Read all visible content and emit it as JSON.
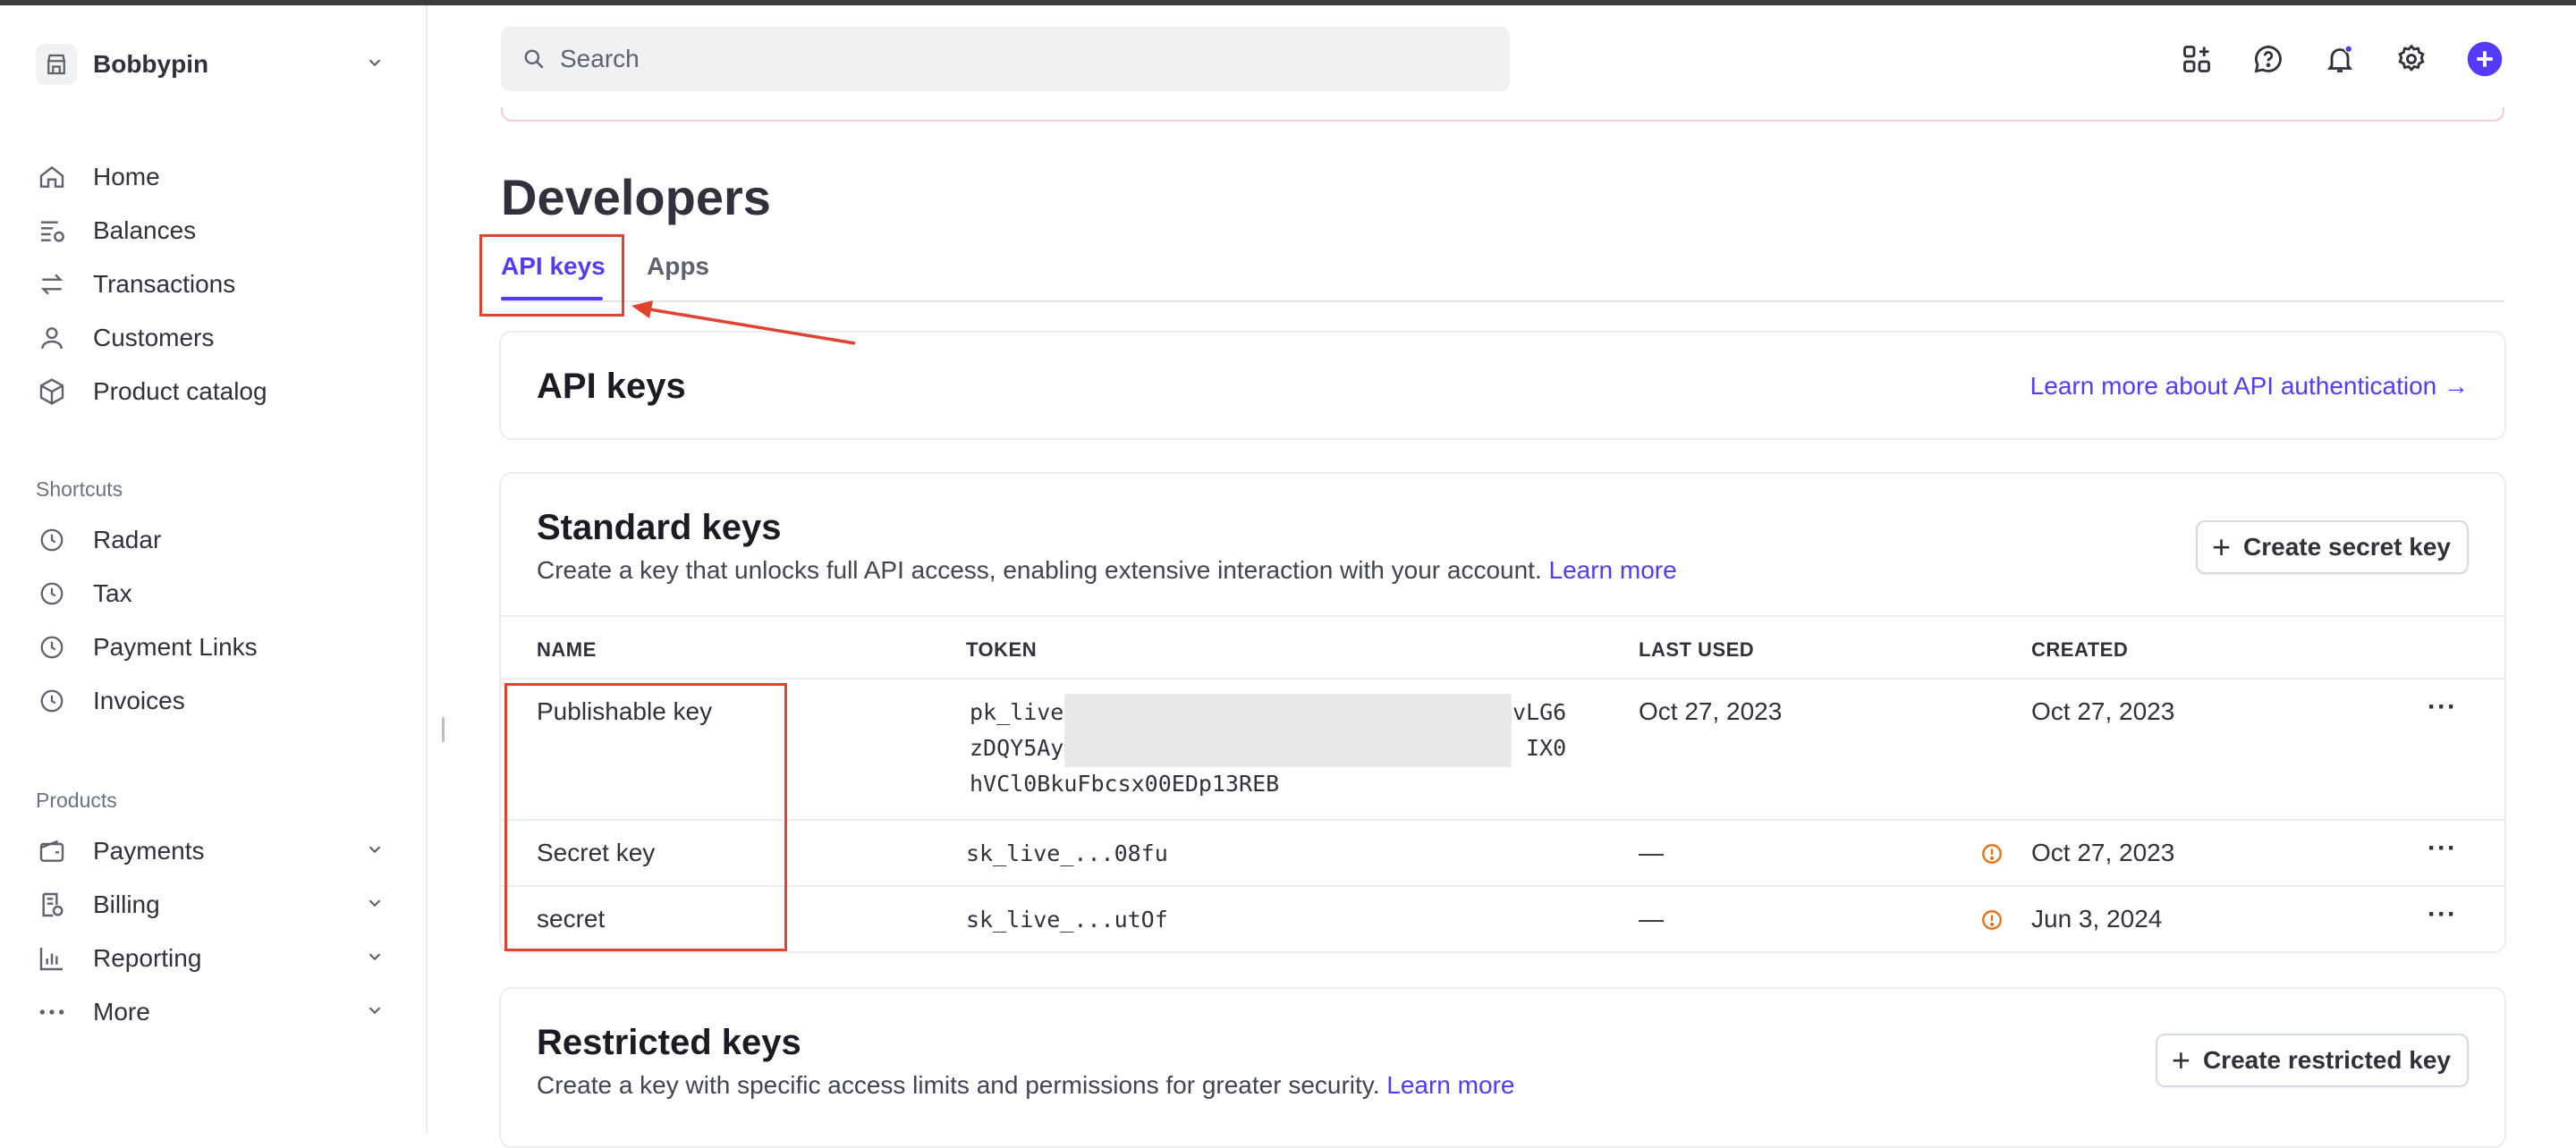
{
  "account": {
    "name": "Bobbypin"
  },
  "nav": {
    "main": [
      {
        "label": "Home",
        "icon": "home-icon"
      },
      {
        "label": "Balances",
        "icon": "balances-icon"
      },
      {
        "label": "Transactions",
        "icon": "transactions-icon"
      },
      {
        "label": "Customers",
        "icon": "customers-icon"
      },
      {
        "label": "Product catalog",
        "icon": "product-catalog-icon"
      }
    ],
    "shortcuts_label": "Shortcuts",
    "shortcuts": [
      {
        "label": "Radar",
        "icon": "clock-icon"
      },
      {
        "label": "Tax",
        "icon": "clock-icon"
      },
      {
        "label": "Payment Links",
        "icon": "clock-icon"
      },
      {
        "label": "Invoices",
        "icon": "clock-icon"
      }
    ],
    "products_label": "Products",
    "products": [
      {
        "label": "Payments",
        "icon": "wallet-icon"
      },
      {
        "label": "Billing",
        "icon": "billing-icon"
      },
      {
        "label": "Reporting",
        "icon": "reporting-icon"
      },
      {
        "label": "More",
        "icon": "more-dots-icon"
      }
    ]
  },
  "search": {
    "placeholder": "Search"
  },
  "page": {
    "title": "Developers",
    "tabs": [
      {
        "label": "API keys"
      },
      {
        "label": "Apps"
      }
    ]
  },
  "api_keys_card": {
    "title": "API keys",
    "learn_link": "Learn more about API authentication →"
  },
  "standard_keys": {
    "title": "Standard keys",
    "description": "Create a key that unlocks full API access, enabling extensive interaction with your account.",
    "learn_more": "Learn more",
    "create_button": "Create secret key",
    "columns": [
      "NAME",
      "TOKEN",
      "LAST USED",
      "CREATED"
    ],
    "rows": [
      {
        "name": "Publishable key",
        "token_lines": [
          "pk_live",
          "vLG6",
          "zDQY5Ay",
          "IX0",
          "hVCl0BkuFbcsx00EDp13REB"
        ],
        "last_used": "Oct 27, 2023",
        "created": "Oct 27, 2023"
      },
      {
        "name": "Secret key",
        "token": "sk_live_...08fu",
        "last_used": "—",
        "created": "Oct 27, 2023"
      },
      {
        "name": "secret",
        "token": "sk_live_...utOf",
        "last_used": "—",
        "created": "Jun 3, 2024"
      }
    ],
    "more_label": "···"
  },
  "restricted_keys": {
    "title": "Restricted keys",
    "description": "Create a key with specific access limits and permissions for greater security.",
    "learn_more": "Learn more",
    "create_button": "Create restricted key"
  },
  "colors": {
    "accent": "#533afd",
    "annotation": "#e0432e",
    "warning": "#e5721a"
  }
}
